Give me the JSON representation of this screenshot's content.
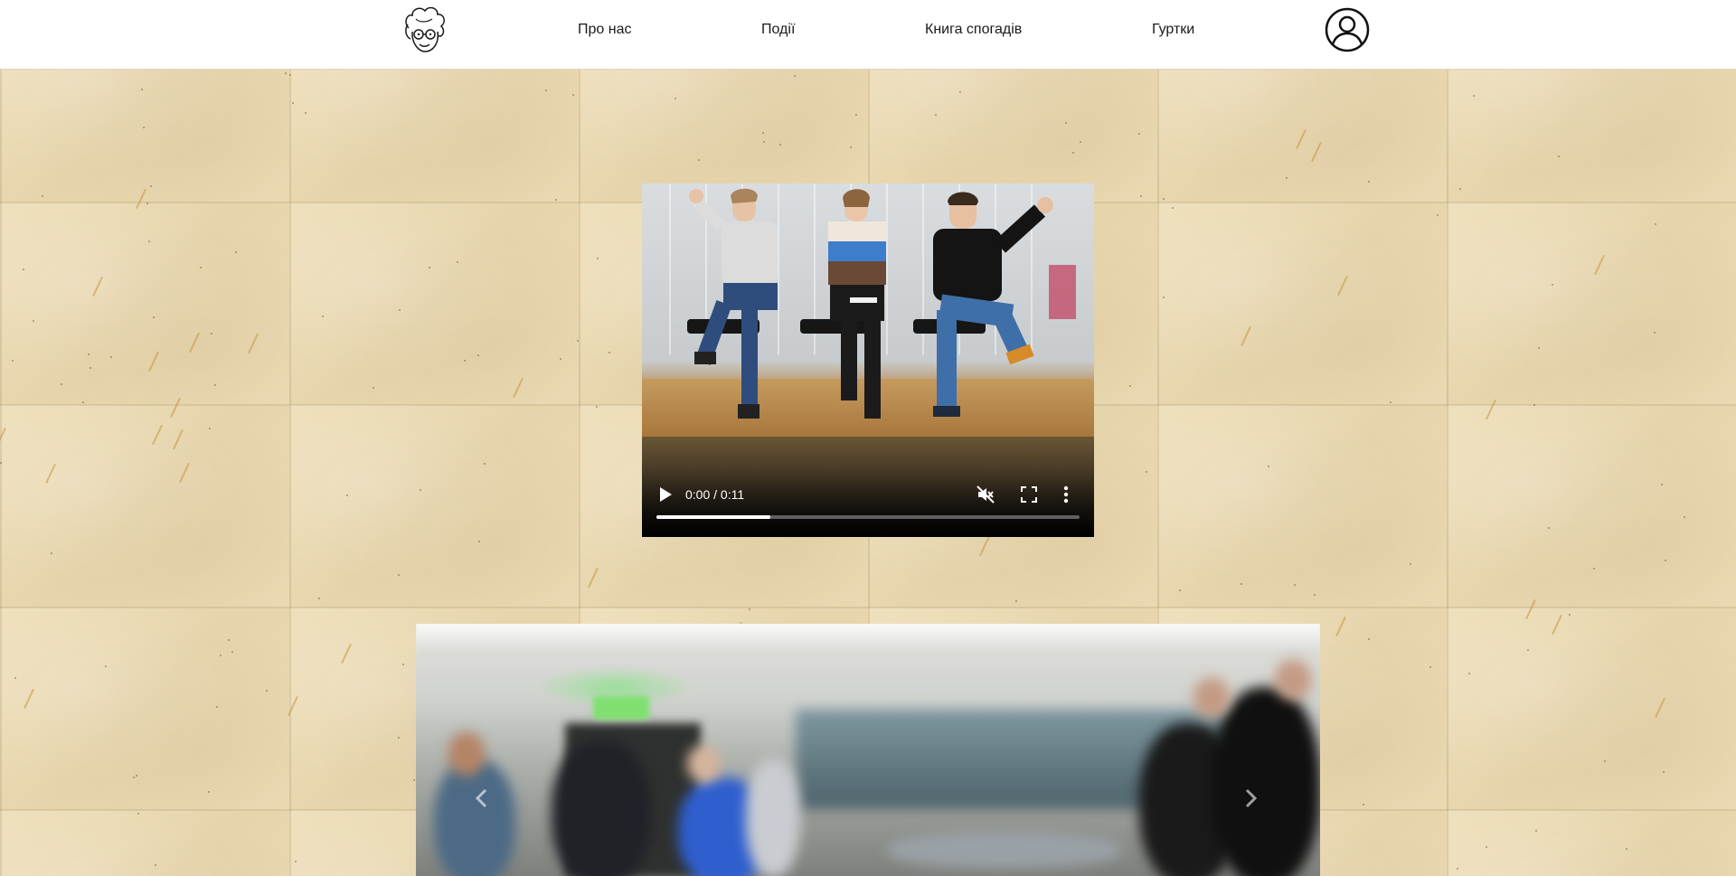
{
  "header": {
    "logo_icon": "grandma-face-logo",
    "nav": [
      {
        "label": "Про нас"
      },
      {
        "label": "Події"
      },
      {
        "label": "Книга спогадів"
      },
      {
        "label": "Гуртки"
      }
    ],
    "account_icon": "user-circle-icon"
  },
  "video": {
    "time": "0:00 / 0:11",
    "progress": 0.27,
    "muted": true,
    "controls": [
      "play-icon",
      "mute-icon",
      "fullscreen-icon",
      "more-vert-icon"
    ]
  },
  "carousel": {
    "prev_icon": "chevron-left-icon",
    "next_icon": "chevron-right-icon"
  },
  "colors": {
    "header_bg": "#ffffff",
    "page_bg": "#e9d9b4",
    "nav_text": "#1a1a1a"
  }
}
